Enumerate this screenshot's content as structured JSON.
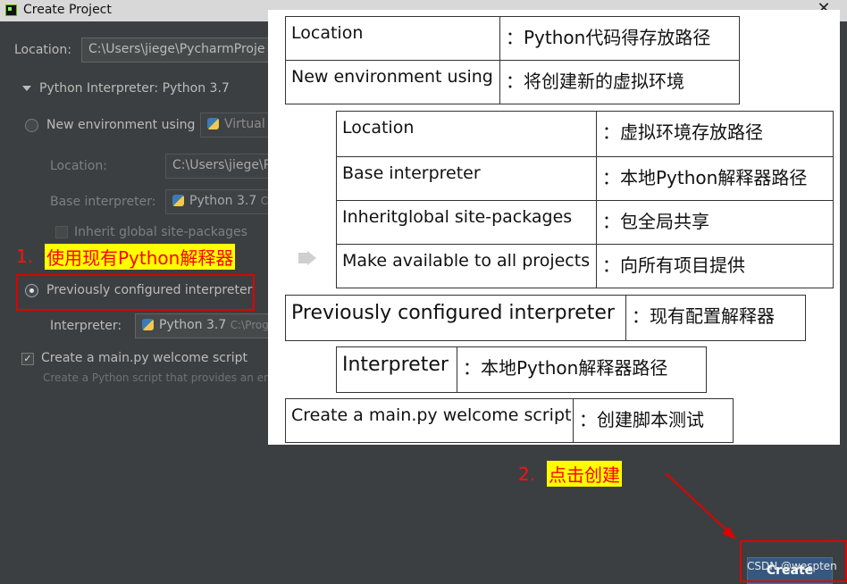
{
  "window": {
    "title": "Create Project",
    "close_glyph": "✕"
  },
  "dialog": {
    "location_label": "Location:",
    "location_value": "C:\\Users\\jiege\\PycharmProje",
    "interpreter_section": "Python Interpreter: Python 3.7",
    "new_env_label": "New environment using",
    "new_env_value": "Virtual",
    "env_location_label": "Location:",
    "env_location_value": "C:\\Users\\jiege\\P",
    "base_interpreter_label": "Base interpreter:",
    "base_interpreter_value": "Python 3.7",
    "base_interpreter_suffix": "C",
    "inherit_label": "Inherit global site-packages",
    "previously_label": "Previously configured interpreter",
    "interpreter_label": "Interpreter:",
    "interpreter_value": "Python 3.7",
    "interpreter_path": "C:\\Prog",
    "main_py_label": "Create a main.py welcome script",
    "main_py_hint": "Create a Python script that provides an entr",
    "create_button": "Create"
  },
  "annotations": {
    "step1_number": "1.",
    "step1_text": "使用现有Python解释器",
    "step2_number": "2.",
    "step2_text": "点击创建",
    "watermark": "CSDN @wespten"
  },
  "overlay_table": {
    "location_key": "Location",
    "location_desc": "：Python代码得存放路径",
    "new_env_key": "New environment using",
    "new_env_desc": "：将创建新的虚拟环境",
    "sub_location_key": "Location",
    "sub_location_desc": "：虚拟环境存放路径",
    "base_key": "Base interpreter",
    "base_desc": "：本地Python解释器路径",
    "inherit_key": "Inheritglobal site-packages",
    "inherit_desc": "：包全局共享",
    "make_available_key": "Make available to all projects",
    "make_available_desc": "：向所有项目提供",
    "previously_key": "Previously configured interpreter",
    "previously_desc": "：现有配置解释器",
    "interpreter_key": "Interpreter",
    "interpreter_desc": "：本地Python解释器路径",
    "main_py_key": "Create a main.py welcome script",
    "main_py_desc": "：创建脚本测试"
  }
}
